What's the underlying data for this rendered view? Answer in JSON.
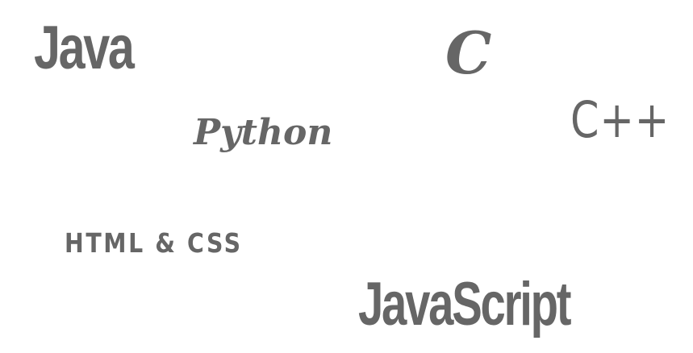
{
  "text_color": "#666666",
  "background_color": "#ffffff",
  "words": {
    "java": "Java",
    "c": "C",
    "python": "Python",
    "cpp": "C++",
    "html_css": "HTML & CSS",
    "javascript": "JavaScript"
  }
}
